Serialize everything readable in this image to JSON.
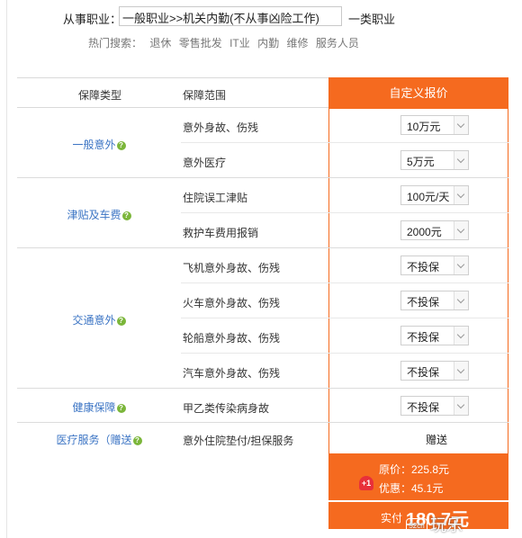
{
  "job": {
    "label": "从事职业：",
    "value": "一般职业>>机关内勤(不从事凶险工作)",
    "class_label": "一类职业"
  },
  "hot_search": {
    "label": "热门搜索：",
    "items": [
      "退休",
      "零售批发",
      "IT业",
      "内勤",
      "维修",
      "服务人员"
    ]
  },
  "table": {
    "headers": {
      "type": "保障类型",
      "scope": "保障范围",
      "price": "自定义报价"
    },
    "groups": [
      {
        "name": "一般意外",
        "items": [
          {
            "scope": "意外身故、伤残",
            "value": "10万元"
          },
          {
            "scope": "意外医疗",
            "value": "5万元"
          }
        ]
      },
      {
        "name": "津贴及车费",
        "items": [
          {
            "scope": "住院误工津贴",
            "value": "100元/天"
          },
          {
            "scope": "救护车费用报销",
            "value": "2000元"
          }
        ]
      },
      {
        "name": "交通意外",
        "items": [
          {
            "scope": "飞机意外身故、伤残",
            "value": "不投保"
          },
          {
            "scope": "火车意外身故、伤残",
            "value": "不投保"
          },
          {
            "scope": "轮船意外身故、伤残",
            "value": "不投保"
          },
          {
            "scope": "汽车意外身故、伤残",
            "value": "不投保"
          }
        ]
      },
      {
        "name": "健康保障",
        "items": [
          {
            "scope": "甲乙类传染病身故",
            "value": "不投保"
          }
        ]
      },
      {
        "name": "医疗服务（赠送",
        "items": [
          {
            "scope": "意外住院垫付/担保服务",
            "value": "赠送"
          }
        ]
      }
    ]
  },
  "summary": {
    "original": "原价：225.8元",
    "discount": "优惠：45.1元",
    "coupon_badge": "+1",
    "pay_label": "实付",
    "pay_amount": "180.7元"
  },
  "watermark": {
    "logo": "52ch",
    "text": "玩乐"
  },
  "icons": {
    "help": "help-circle-icon",
    "dropdown": "chevron-down-icon",
    "coupon": "coupon-badge-icon"
  },
  "colors": {
    "accent": "#f56a1f",
    "link": "#3b74c4",
    "help": "#7bb63a"
  }
}
